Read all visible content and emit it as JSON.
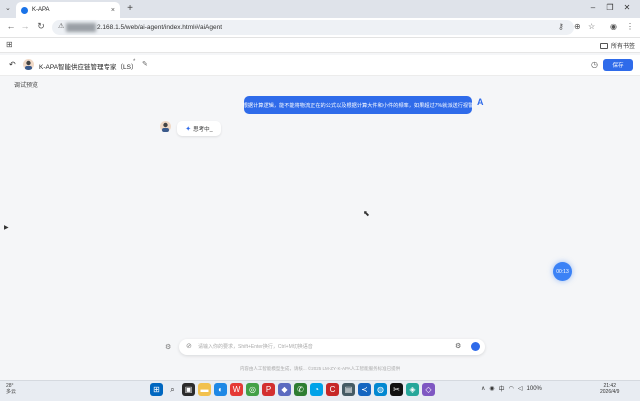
{
  "browser": {
    "tab_title": "K-APA",
    "tab_close": "×",
    "new_tab": "+",
    "tab_menu": "⌄",
    "win_min": "–",
    "win_max": "❐",
    "win_close": "✕",
    "url": "2.168.1.5/web/ai-agent/index.html#/aiAgent",
    "bookmarks_all": "所有书签"
  },
  "app": {
    "title": "K-APA智能供应链管理专家（LS）",
    "title_mark": "*",
    "save_label": "保存",
    "preview_label": "调试预览",
    "user_message": "根据计算逻辑，能不能将物流正在的公式以及根据计算大件和小件的频率，如果超过7%就派送行视警",
    "user_avatar": "A",
    "thinking_text": "思考中_",
    "float_badge": "00:13",
    "input_placeholder": "请输入你的要求，Shift+Enter换行，Ctrl+M切换语音",
    "footer": "内容由人工智能模型生成，请核... ©2025 LM-ZY·K-APA人工智能服务标准已提供"
  },
  "taskbar": {
    "weather_temp": "28°",
    "weather_text": "多云",
    "battery": "100%",
    "time": "21:42",
    "date": "2026/4/9"
  },
  "colors": {
    "accent": "#2f6bea",
    "background": "#f5f6f8"
  }
}
